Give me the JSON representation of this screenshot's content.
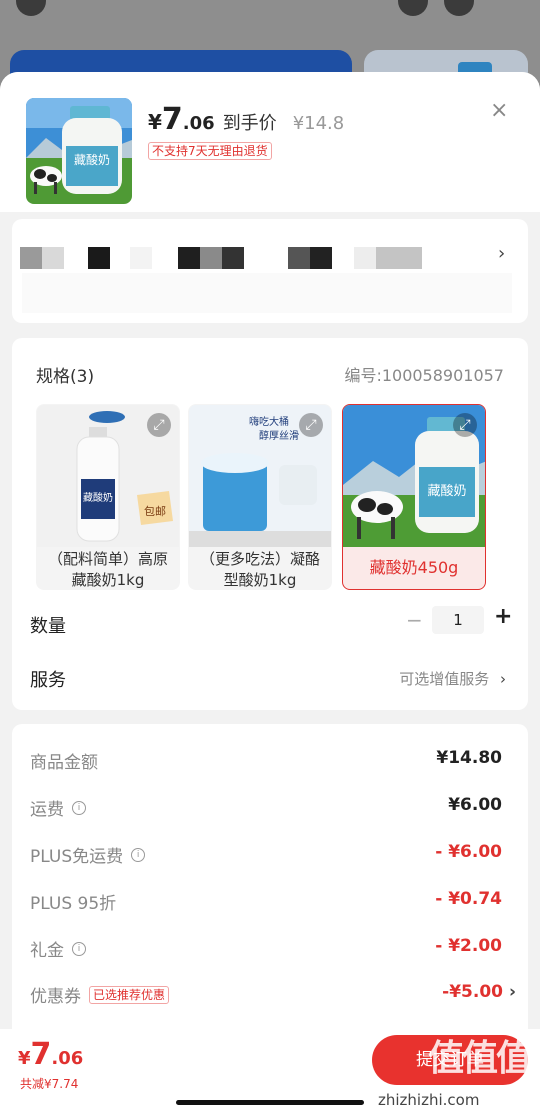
{
  "header": {
    "currency": "¥",
    "price_int": "7",
    "price_dec": ".06",
    "price_tag": "到手价",
    "original_price": "¥14.8",
    "no_return_badge": "不支持7天无理由退货",
    "close_symbol": "×"
  },
  "spec": {
    "title": "规格(3)",
    "code": "编号:100058901057",
    "options": [
      {
        "label": "（配料简单）高原藏酸奶1kg",
        "selected": false
      },
      {
        "label": "（更多吃法）凝酪型酸奶1kg",
        "selected": false
      },
      {
        "label": "藏酸奶450g",
        "selected": true
      }
    ],
    "quantity_label": "数量",
    "quantity_minus": "−",
    "quantity": "1",
    "quantity_plus": "+",
    "service_label": "服务",
    "service_value": "可选增值服务"
  },
  "cost": {
    "rows": [
      {
        "label": "商品金额",
        "value": "¥14.80"
      },
      {
        "label": "运费",
        "value": "¥6.00"
      },
      {
        "label": "PLUS免运费",
        "value": "- ¥6.00"
      },
      {
        "label": "PLUS 95折",
        "value": "- ¥0.74"
      },
      {
        "label": "礼金",
        "value": "- ¥2.00"
      },
      {
        "label": "优惠券",
        "value": "-¥5.00"
      }
    ],
    "coupon_tag": "已选推荐优惠"
  },
  "footer": {
    "currency": "¥",
    "price_int": "7",
    "price_dec": ".06",
    "saved": "共减¥7.74",
    "submit": "提交订单",
    "watermark": "值值值",
    "watermark_url": "zhizhizhi.com"
  },
  "icons": {
    "chevron": "›",
    "info": "i",
    "expand": "⤢"
  },
  "colors": {
    "accent": "#e0312f",
    "submit_bg": "#e8322e"
  }
}
